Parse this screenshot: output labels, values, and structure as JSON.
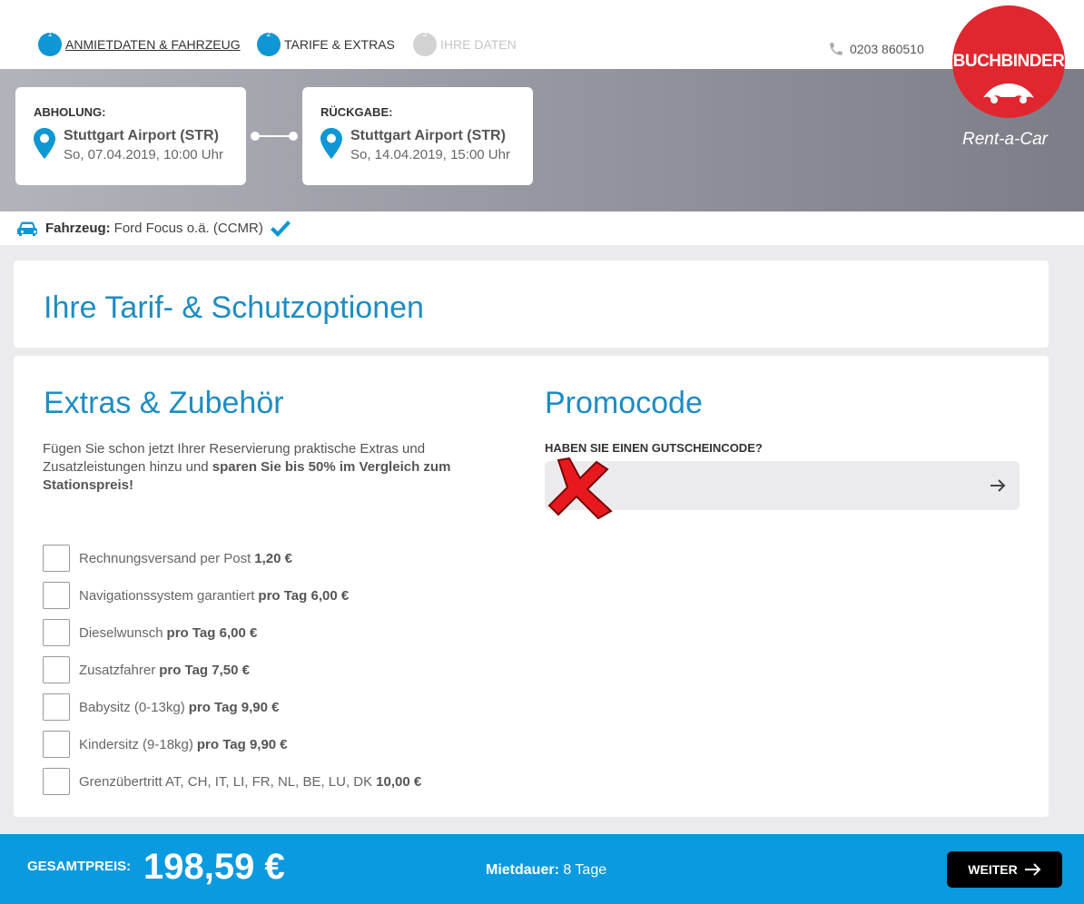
{
  "steps": [
    {
      "number": "1",
      "label": "ANMIETDATEN & FAHRZEUG"
    },
    {
      "number": "2",
      "label": "TARIFE & EXTRAS"
    },
    {
      "number": "3",
      "label": "IHRE DATEN"
    }
  ],
  "header": {
    "phone": "0203 860510",
    "logo_text": "BUCHBINDER",
    "tagline": "Rent-a-Car"
  },
  "pickup": {
    "caption": "ABHOLUNG:",
    "place": "Stuttgart Airport (STR)",
    "date": "So, 07.04.2019, 10:00 Uhr"
  },
  "return": {
    "caption": "RÜCKGABE:",
    "place": "Stuttgart Airport (STR)",
    "date": "So, 14.04.2019, 15:00 Uhr"
  },
  "vehicle": {
    "label": "Fahrzeug:",
    "value": "Ford Focus o.ä. (CCMR)"
  },
  "page_title": "Ihre Tarif- & Schutzoptionen",
  "extras": {
    "title": "Extras & Zubehör",
    "intro_plain": "Fügen Sie schon jetzt Ihrer Reservierung praktische Extras und Zusatzleistungen hinzu und ",
    "intro_bold": "sparen Sie bis 50% im Vergleich zum Stationspreis!",
    "items": [
      {
        "name": "Rechnungsversand per Post",
        "price": "1,20 €"
      },
      {
        "name": "Navigationssystem garantiert",
        "price": "pro Tag 6,00 €"
      },
      {
        "name": "Dieselwunsch",
        "price": "pro Tag 6,00 €"
      },
      {
        "name": "Zusatzfahrer",
        "price": "pro Tag 7,50 €"
      },
      {
        "name": "Babysitz (0-13kg)",
        "price": "pro Tag 9,90 €"
      },
      {
        "name": "Kindersitz (9-18kg)",
        "price": "pro Tag 9,90 €"
      },
      {
        "name": "Grenzübertritt AT, CH, IT, LI, FR, NL, BE, LU, DK",
        "price": "10,00 €"
      }
    ]
  },
  "promo": {
    "title": "Promocode",
    "label": "HABEN SIE EINEN GUTSCHEINCODE?",
    "value": "",
    "placeholder": ""
  },
  "footer": {
    "total_label": "GESAMTPREIS:",
    "total": "198,59 €",
    "duration_label": "Mietdauer:",
    "duration_value": "8 Tage",
    "next_label": "WEITER"
  },
  "colors": {
    "accent": "#0f96d4",
    "footer": "#0a9ae0",
    "brand_red": "#e0262f",
    "heading": "#1e8cc2"
  }
}
